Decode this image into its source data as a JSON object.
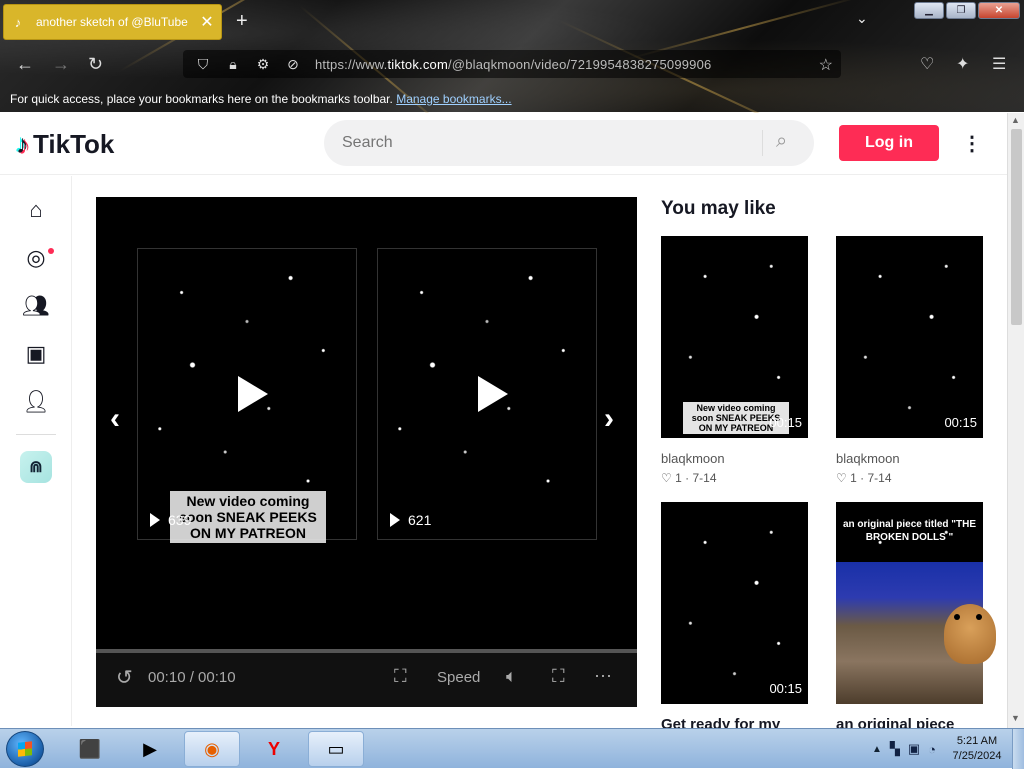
{
  "browser": {
    "tab_title": "another sketch of @BluTube",
    "tab_close": "✕",
    "new_tab": "+",
    "url_prefix": "https://www.",
    "url_domain": "tiktok.com",
    "url_path": "/@blaqkmoon/video/7219954838275099906",
    "bookmarks_text": "For quick access, place your bookmarks here on the bookmarks toolbar.",
    "bookmarks_link": "Manage bookmarks..."
  },
  "header": {
    "logo_text": "TikTok",
    "search_placeholder": "Search",
    "login_label": "Log in"
  },
  "player": {
    "thumbs": [
      {
        "caption": "New video coming soon SNEAK PEEKS ON MY PATREON",
        "views": "639"
      },
      {
        "caption": "",
        "views": "621"
      }
    ],
    "time": "00:10 / 00:10",
    "speed_label": "Speed"
  },
  "recommendations": {
    "title": "You may like",
    "cards": [
      {
        "caption": "New video coming soon SNEAK PEEKS ON MY PATREON",
        "duration": "00:15",
        "user": "blaqkmoon",
        "likes": "1",
        "date": "7-14",
        "title": ""
      },
      {
        "caption": "",
        "duration": "00:15",
        "user": "blaqkmoon",
        "likes": "1",
        "date": "7-14",
        "title": ""
      },
      {
        "caption": "",
        "duration": "00:15",
        "user": "",
        "likes": "",
        "date": "",
        "title": "Get ready for my"
      },
      {
        "caption": "an original piece titled \"THE BROKEN DOLLS \"",
        "duration": "",
        "user": "",
        "likes": "",
        "date": "",
        "title": "an original piece"
      }
    ]
  },
  "taskbar": {
    "time": "5:21 AM",
    "date": "7/25/2024"
  },
  "colors": {
    "accent": "#fe2c55",
    "tab_active": "#d9b62a"
  }
}
